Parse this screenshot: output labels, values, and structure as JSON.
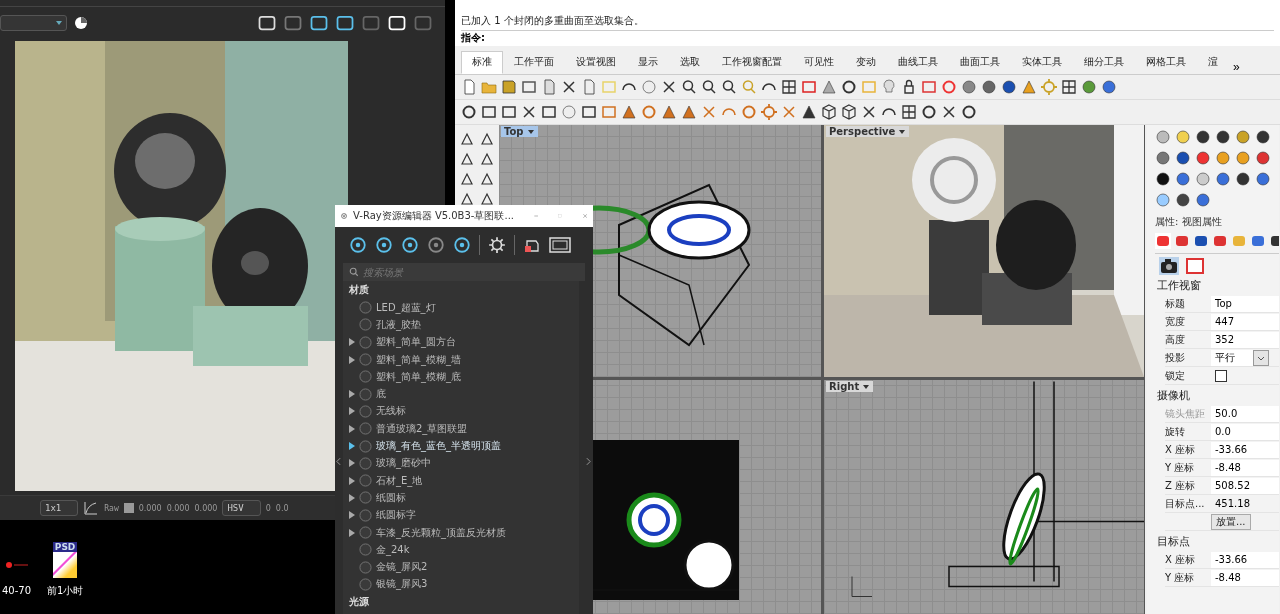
{
  "renderer": {
    "status": {
      "zoom": "1x1",
      "channel": "Raw",
      "values": [
        "0.000",
        "0.000",
        "0.000"
      ],
      "color_mode": "HSV",
      "readings": [
        "0",
        "0.0"
      ]
    }
  },
  "desktop": {
    "icons": [
      {
        "kind": "red",
        "label": "40-70"
      },
      {
        "kind": "psd",
        "badge": "PSD",
        "label": "前1小时"
      }
    ]
  },
  "rhino": {
    "history": [
      "已加入 1 个封闭的多重曲面至选取集合。"
    ],
    "prompt": "指令:",
    "tabs": [
      {
        "label": "标准",
        "selected": true
      },
      {
        "label": "工作平面",
        "selected": false
      },
      {
        "label": "设置视图",
        "selected": false
      },
      {
        "label": "显示",
        "selected": false
      },
      {
        "label": "选取",
        "selected": false
      },
      {
        "label": "工作视窗配置",
        "selected": false
      },
      {
        "label": "可见性",
        "selected": false
      },
      {
        "label": "变动",
        "selected": false
      },
      {
        "label": "曲线工具",
        "selected": false
      },
      {
        "label": "曲面工具",
        "selected": false
      },
      {
        "label": "实体工具",
        "selected": false
      },
      {
        "label": "细分工具",
        "selected": false
      },
      {
        "label": "网格工具",
        "selected": false
      },
      {
        "label": "渲",
        "selected": false
      }
    ],
    "tabs_more": "»",
    "viewports": [
      {
        "kind": "top",
        "title": "Top",
        "active": true
      },
      {
        "kind": "perspective",
        "title": "Perspective",
        "active": false
      },
      {
        "kind": "front"
      },
      {
        "kind": "right",
        "title": "Right",
        "active": false
      }
    ]
  },
  "properties": {
    "title": "属性: 视图属性",
    "sections": [
      {
        "heading": "工作视窗",
        "rows": [
          {
            "kind": "text",
            "label": "标题",
            "value": "Top",
            "disabled": false
          },
          {
            "kind": "text",
            "label": "宽度",
            "value": "447",
            "disabled": false
          },
          {
            "kind": "text",
            "label": "高度",
            "value": "352",
            "disabled": false
          },
          {
            "kind": "select",
            "label": "投影",
            "value": "平行",
            "disabled": false
          },
          {
            "kind": "checkbox",
            "label": "锁定",
            "checked": false,
            "disabled": false
          }
        ]
      },
      {
        "heading": "摄像机",
        "rows": [
          {
            "kind": "text",
            "label": "镜头焦距",
            "value": "50.0",
            "disabled": true
          },
          {
            "kind": "text",
            "label": "旋转",
            "value": "0.0",
            "disabled": false
          },
          {
            "kind": "text",
            "label": "X 座标",
            "value": "-33.66",
            "disabled": false
          },
          {
            "kind": "text",
            "label": "Y 座标",
            "value": "-8.48",
            "disabled": false
          },
          {
            "kind": "text",
            "label": "Z 座标",
            "value": "508.52",
            "disabled": false
          },
          {
            "kind": "readonly",
            "label": "目标点...",
            "value": "451.18",
            "disabled": false
          },
          {
            "kind": "button",
            "value": "放置...",
            "disabled": false
          }
        ]
      },
      {
        "heading": "目标点",
        "rows": [
          {
            "kind": "text",
            "label": "X 座标",
            "value": "-33.66",
            "disabled": false
          },
          {
            "kind": "text",
            "label": "Y 座标",
            "value": "-8.48",
            "disabled": false
          }
        ]
      }
    ]
  },
  "vray": {
    "title": "V-Ray资源编辑器 V5.0B3-草图联...",
    "search": {
      "placeholder": "搜索场景"
    },
    "materials": {
      "heading": "材质",
      "items": [
        {
          "label": "LED_超蓝_灯",
          "expandable": false,
          "highlighted": false
        },
        {
          "label": "孔液_胶垫",
          "expandable": false,
          "highlighted": false
        },
        {
          "label": "塑料_简单_圆方台",
          "expandable": true,
          "highlighted": false
        },
        {
          "label": "塑料_简单_模糊_墙",
          "expandable": true,
          "highlighted": false
        },
        {
          "label": "塑料_简单_模糊_底",
          "expandable": false,
          "highlighted": false
        },
        {
          "label": "底",
          "expandable": true,
          "highlighted": false
        },
        {
          "label": "无线标",
          "expandable": true,
          "highlighted": false
        },
        {
          "label": "普通玻璃2_草图联盟",
          "expandable": true,
          "highlighted": false
        },
        {
          "label": "玻璃_有色_蓝色_半透明顶盖",
          "expandable": true,
          "highlighted": true
        },
        {
          "label": "玻璃_磨砂中",
          "expandable": true,
          "highlighted": false
        },
        {
          "label": "石材_E_地",
          "expandable": true,
          "highlighted": false
        },
        {
          "label": "纸圆标",
          "expandable": true,
          "highlighted": false
        },
        {
          "label": "纸圆标字",
          "expandable": true,
          "highlighted": false
        },
        {
          "label": "车漆_反光颗粒_顶盖反光材质",
          "expandable": true,
          "highlighted": false
        },
        {
          "label": "金_24k",
          "expandable": false,
          "highlighted": false
        },
        {
          "label": "金镜_屏风2",
          "expandable": false,
          "highlighted": false
        },
        {
          "label": "银镜_屏风3",
          "expandable": false,
          "highlighted": false
        }
      ]
    },
    "lights": {
      "heading": "光源"
    }
  }
}
